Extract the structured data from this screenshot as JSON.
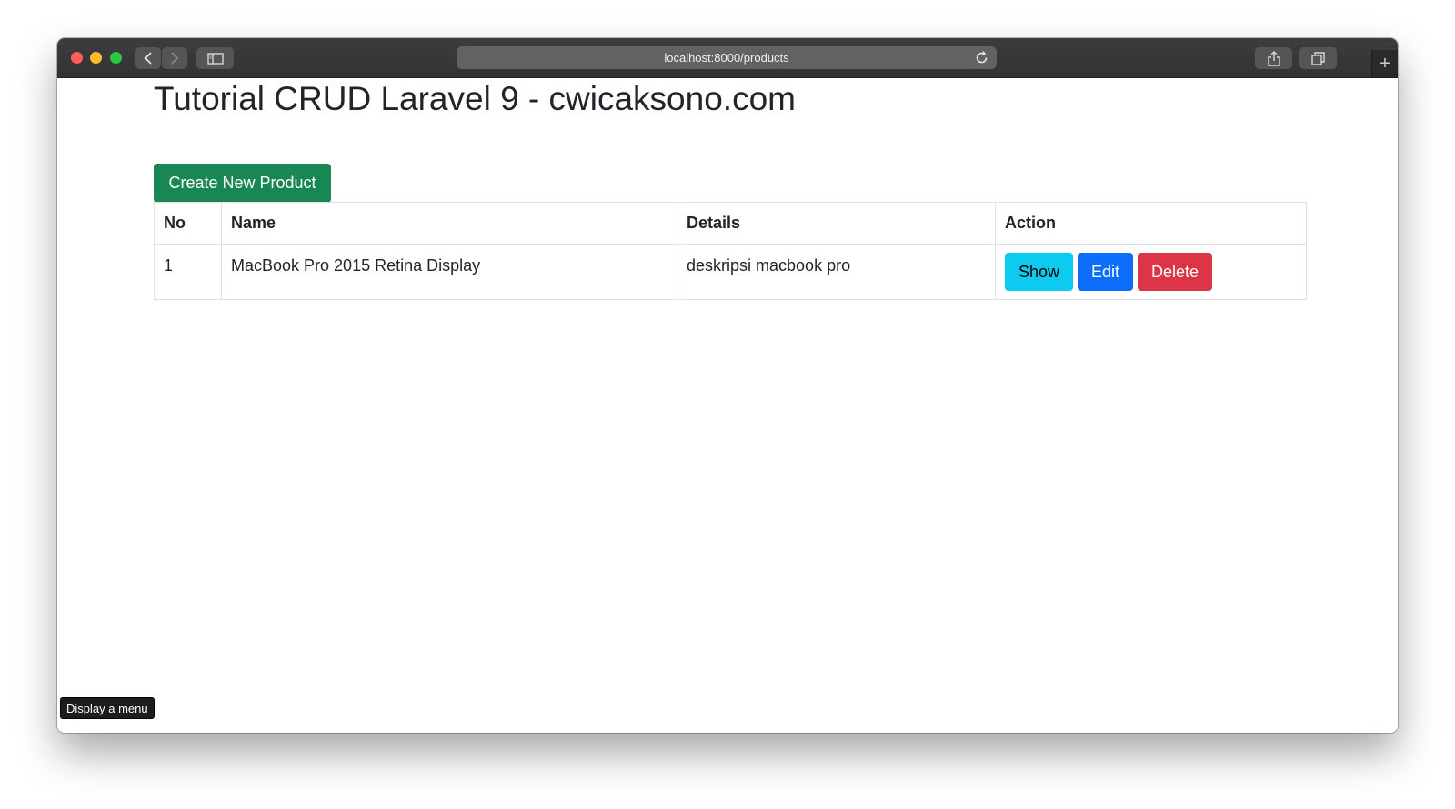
{
  "browser": {
    "url": "localhost:8000/products",
    "new_tab_symbol": "+",
    "icons": [
      "back-icon",
      "forward-icon",
      "sidebar-icon",
      "reload-icon",
      "share-icon",
      "tabs-overview-icon",
      "plus-icon"
    ]
  },
  "page": {
    "title": "Tutorial CRUD Laravel 9 - cwicaksono.com",
    "create_button": "Create New Product"
  },
  "table": {
    "headers": [
      "No",
      "Name",
      "Details",
      "Action"
    ],
    "rows": [
      {
        "no": "1",
        "name": "MacBook Pro 2015 Retina Display",
        "details": "deskripsi macbook pro",
        "actions": [
          "Show",
          "Edit",
          "Delete"
        ]
      }
    ]
  },
  "tooltip": "Display a menu",
  "colors": {
    "create": "#198754",
    "show": "#0dcaf0",
    "edit": "#0d6efd",
    "delete": "#dc3545"
  }
}
